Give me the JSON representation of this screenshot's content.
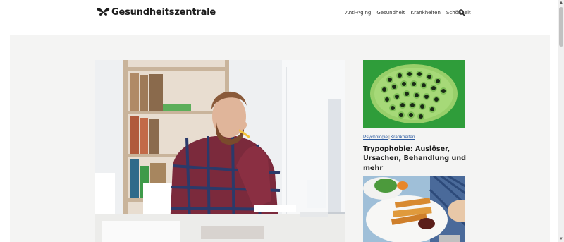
{
  "header": {
    "logo_text": "Gesundheitszentrale",
    "logo_icon": "butterfly-icon",
    "nav": [
      "Anti-Aging",
      "Gesundheit",
      "Krankheiten",
      "Schönheit"
    ],
    "search_icon": "search-icon"
  },
  "hero": {
    "image": "man-thinking-at-desk-photo"
  },
  "sidebar_cards": [
    {
      "image": "lotus-seed-pod-photo",
      "categories": [
        "Psychologie",
        "Krankheiten"
      ],
      "title": "Trypophobie: Auslöser, Ursachen, Behandlung und mehr"
    },
    {
      "image": "food-plate-photo"
    }
  ],
  "colors": {
    "page_bg": "#ffffff",
    "content_bg": "#f4f4f3",
    "link": "#2c5aa0",
    "text": "#1a1a1a"
  }
}
